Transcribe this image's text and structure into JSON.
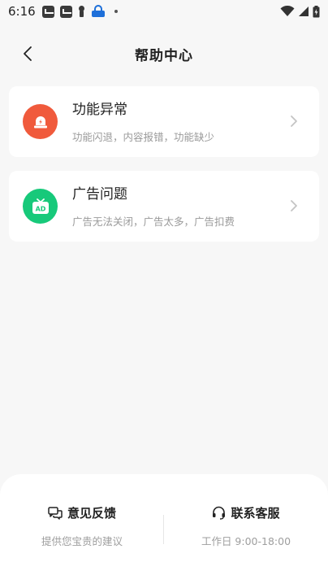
{
  "status_bar": {
    "time": "6:16",
    "icons": [
      "mail-box-icon",
      "mail-box-icon",
      "person-icon",
      "lock-app-icon",
      "dot-icon",
      "wifi-icon",
      "signal-icon",
      "battery-icon"
    ]
  },
  "header": {
    "title": "帮助中心",
    "back_icon": "chevron-left-icon"
  },
  "cards": [
    {
      "title": "功能异常",
      "subtitle": "功能闪退，内容报错，功能缺少",
      "icon": "alert-bell-icon",
      "color": "#f05a3c"
    },
    {
      "title": "广告问题",
      "subtitle": "广告无法关闭，广告太多，广告扣费",
      "icon": "ad-tv-icon",
      "color": "#17c97a"
    }
  ],
  "bottom": {
    "feedback": {
      "title": "意见反馈",
      "subtitle": "提供您宝贵的建议",
      "icon": "chat-bubbles-icon"
    },
    "service": {
      "title": "联系客服",
      "subtitle": "工作日 9:00-18:00",
      "icon": "headset-icon"
    }
  }
}
